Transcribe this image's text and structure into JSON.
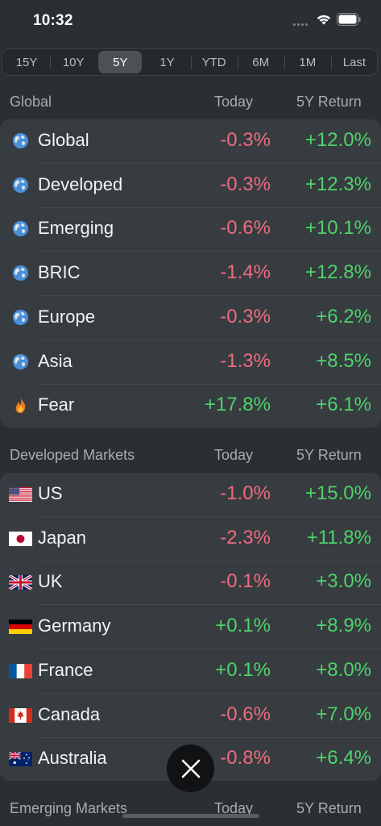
{
  "status": {
    "time": "10:32"
  },
  "periods": [
    "15Y",
    "10Y",
    "5Y",
    "1Y",
    "YTD",
    "6M",
    "1M",
    "Last"
  ],
  "selected_period": "5Y",
  "sections": {
    "global": {
      "title": "Global",
      "col_today": "Today",
      "col_return": "5Y Return",
      "rows": [
        {
          "icon": "globe-icon",
          "name": "Global",
          "today": "-0.3%",
          "ret": "+12.0%"
        },
        {
          "icon": "globe-icon",
          "name": "Developed",
          "today": "-0.3%",
          "ret": "+12.3%"
        },
        {
          "icon": "globe-icon",
          "name": "Emerging",
          "today": "-0.6%",
          "ret": "+10.1%"
        },
        {
          "icon": "globe-icon",
          "name": "BRIC",
          "today": "-1.4%",
          "ret": "+12.8%"
        },
        {
          "icon": "globe-icon",
          "name": "Europe",
          "today": "-0.3%",
          "ret": "+6.2%"
        },
        {
          "icon": "globe-icon",
          "name": "Asia",
          "today": "-1.3%",
          "ret": "+8.5%"
        },
        {
          "icon": "fire-icon",
          "name": "Fear",
          "today": "+17.8%",
          "ret": "+6.1%"
        }
      ]
    },
    "developed": {
      "title": "Developed Markets",
      "col_today": "Today",
      "col_return": "5Y Return",
      "rows": [
        {
          "icon": "us-flag-icon",
          "name": "US",
          "today": "-1.0%",
          "ret": "+15.0%"
        },
        {
          "icon": "japan-flag-icon",
          "name": "Japan",
          "today": "-2.3%",
          "ret": "+11.8%"
        },
        {
          "icon": "uk-flag-icon",
          "name": "UK",
          "today": "-0.1%",
          "ret": "+3.0%"
        },
        {
          "icon": "germany-flag-icon",
          "name": "Germany",
          "today": "+0.1%",
          "ret": "+8.9%"
        },
        {
          "icon": "france-flag-icon",
          "name": "France",
          "today": "+0.1%",
          "ret": "+8.0%"
        },
        {
          "icon": "canada-flag-icon",
          "name": "Canada",
          "today": "-0.6%",
          "ret": "+7.0%"
        },
        {
          "icon": "australia-flag-icon",
          "name": "Australia",
          "today": "-0.8%",
          "ret": "+6.4%"
        }
      ]
    },
    "emerging": {
      "title": "Emerging Markets",
      "col_today": "Today",
      "col_return": "5Y Return"
    }
  },
  "colors": {
    "negative": "#ef6b7e",
    "positive": "#4ed36a",
    "background": "#2b2f33",
    "card": "#373c40"
  },
  "close_icon": "close-icon"
}
